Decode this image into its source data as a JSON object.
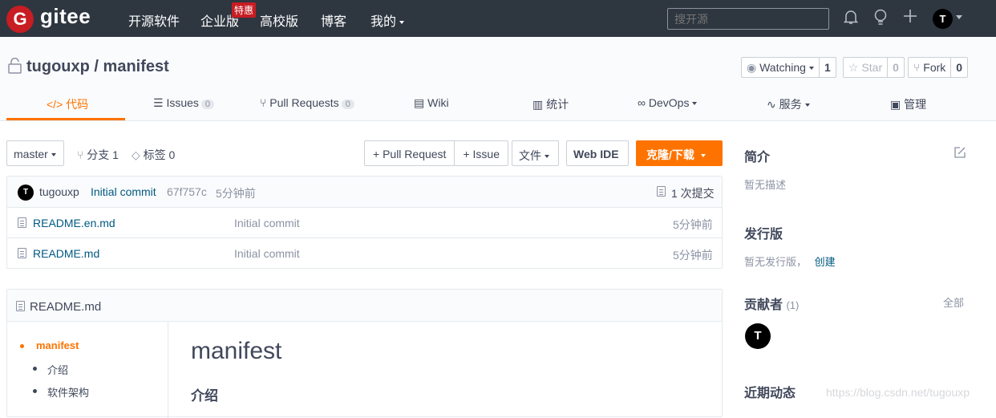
{
  "topnav": {
    "logo_letter": "G",
    "brand": "gitee",
    "items": [
      "开源软件",
      "企业版",
      "高校版",
      "博客",
      "我的"
    ],
    "enterprise_badge": "特惠",
    "search_placeholder": "搜开源",
    "user_initial": "T"
  },
  "repo": {
    "owner": "tugouxp",
    "name": "manifest",
    "title": "tugouxp / manifest",
    "watch_label": "Watching",
    "watch_count": "1",
    "star_label": "Star",
    "star_count": "0",
    "fork_label": "Fork",
    "fork_count": "0"
  },
  "tabs": [
    {
      "icon": "code-icon",
      "glyph": "</>",
      "label": "代码",
      "active": true
    },
    {
      "icon": "issues-icon",
      "glyph": "☰",
      "label": "Issues",
      "badge": "0"
    },
    {
      "icon": "pull-request-icon",
      "glyph": "⑂",
      "label": "Pull Requests",
      "badge": "0"
    },
    {
      "icon": "wiki-icon",
      "glyph": "▤",
      "label": "Wiki"
    },
    {
      "icon": "stats-icon",
      "glyph": "▥",
      "label": "统计"
    },
    {
      "icon": "devops-icon",
      "glyph": "∞",
      "label": "DevOps"
    },
    {
      "icon": "service-icon",
      "glyph": "∿",
      "label": "服务"
    },
    {
      "icon": "manage-icon",
      "glyph": "▣",
      "label": "管理"
    }
  ],
  "toolbar": {
    "branch": "master",
    "branches": "分支 1",
    "tags": "标签 0",
    "pull_request": "+ Pull Request",
    "issue": "+ Issue",
    "files": "文件",
    "web_ide": "Web IDE",
    "clone": "克隆/下载"
  },
  "last_commit": {
    "author_initial": "T",
    "author": "tugouxp",
    "message": "Initial commit",
    "hash": "67f757c",
    "time": "5分钟前",
    "commits": "1 次提交"
  },
  "files": [
    {
      "name": "README.en.md",
      "message": "Initial commit",
      "time": "5分钟前"
    },
    {
      "name": "README.md",
      "message": "Initial commit",
      "time": "5分钟前"
    }
  ],
  "readme": {
    "filename": "README.md",
    "toc": [
      "manifest",
      "介绍",
      "软件架构"
    ],
    "heading": "manifest",
    "subheading": "介绍"
  },
  "sidebar": {
    "intro_title": "简介",
    "intro_text": "暂无描述",
    "release_title": "发行版",
    "release_text": "暂无发行版，",
    "release_create": "创建",
    "contrib_title": "贡献者",
    "contrib_count": "(1)",
    "contrib_all": "全部",
    "contrib_initial": "T",
    "activity_title": "近期动态"
  },
  "watermark": "https://blog.csdn.net/tugouxp",
  "colors": {
    "accent": "#fe7300",
    "topbar": "#2e3640",
    "brand_red": "#c71d23",
    "link": "#005980"
  }
}
